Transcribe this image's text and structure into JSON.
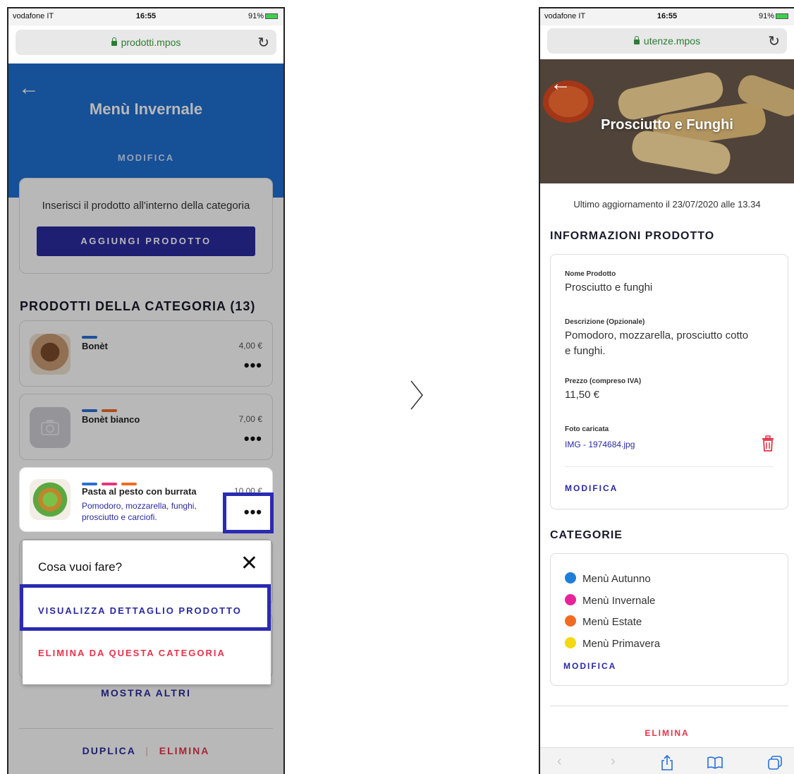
{
  "status": {
    "carrier": "vodafone IT",
    "time": "16:55",
    "battery": "91%"
  },
  "left": {
    "url": "prodotti.mpos",
    "title": "Menù Invernale",
    "edit_label": "MODIFICA",
    "insert_text": "Inserisci il prodotto all'interno della categoria",
    "add_button": "AGGIUNGI PRODOTTO",
    "section_title": "PRODOTTI DELLA CATEGORIA (13)",
    "products": [
      {
        "name": "Bonèt",
        "price": "4,00 €",
        "tags": [
          "#2a6fd6"
        ]
      },
      {
        "name": "Bonèt bianco",
        "price": "7,00 €",
        "tags": [
          "#2a6fd6",
          "#f26b21"
        ]
      },
      {
        "name": "Pasta al pesto con burrata",
        "price": "10,00 €",
        "description": "Pomodoro, mozzarella, funghi, prosciutto e carciofi.",
        "tags": [
          "#2a6fd6",
          "#e8337a",
          "#f26b21"
        ]
      }
    ],
    "more_symbol": "•••",
    "sheet": {
      "title": "Cosa vuoi fare?",
      "view_detail": "VISUALIZZA DETTAGLIO PRODOTTO",
      "remove": "ELIMINA DA QUESTA CATEGORIA"
    },
    "show_more": "MOSTRA ALTRI",
    "duplicate": "DUPLICA",
    "separator": "|",
    "delete": "ELIMINA"
  },
  "right": {
    "url": "utenze.mpos",
    "title": "Prosciutto e Funghi",
    "updated": "Ultimo aggiornamento il 23/07/2020 alle 13.34",
    "info_title": "INFORMAZIONI PRODOTTO",
    "fields": {
      "name_label": "Nome Prodotto",
      "name_value": "Prosciutto e funghi",
      "desc_label": "Descrizione (Opzionale)",
      "desc_value": "Pomodoro, mozzarella, prosciutto cotto e funghi.",
      "price_label": "Prezzo (compreso IVA)",
      "price_value": "11,50 €",
      "photo_label": "Foto caricata",
      "photo_value": "IMG - 1974684.jpg"
    },
    "edit_label": "MODIFICA",
    "categories_title": "CATEGORIE",
    "categories": [
      {
        "label": "Menù Autunno",
        "color": "#1f7fd6"
      },
      {
        "label": "Menù Invernale",
        "color": "#e8239a"
      },
      {
        "label": "Menù Estate",
        "color": "#f26b21"
      },
      {
        "label": "Menù Primavera",
        "color": "#f5d80f"
      }
    ],
    "categories_edit": "MODIFICA",
    "delete": "ELIMINA"
  },
  "colors": {
    "primary": "#2a2aa0",
    "header_blue": "#1f6fd1",
    "danger": "#e8334a",
    "highlight": "#2b2ab3"
  }
}
